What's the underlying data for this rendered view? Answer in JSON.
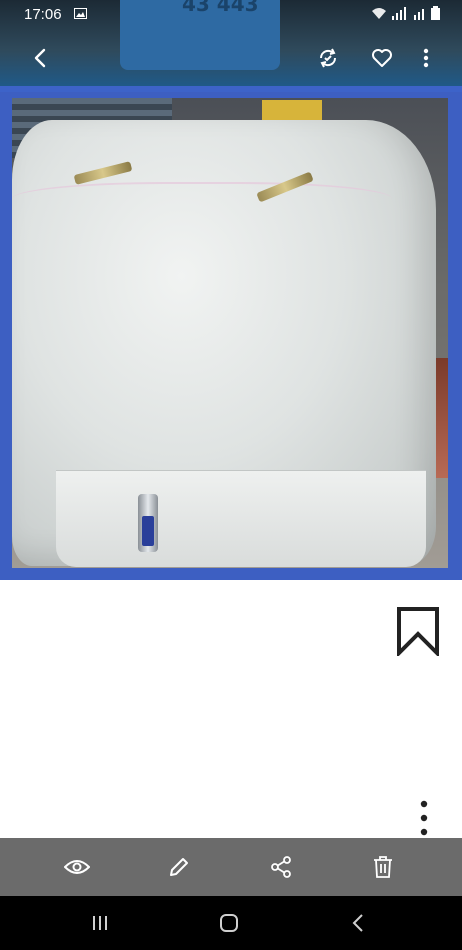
{
  "status_bar": {
    "time": "17:06"
  },
  "app_bar": {
    "icons": [
      "back-arrow-icon",
      "rotate-icon",
      "heart-icon",
      "more-vert-icon"
    ]
  },
  "photo": {
    "description_text_visible_on_box": "43 443"
  },
  "actions": {
    "bookmark": "bookmark-icon",
    "more": "more-vert-icon"
  },
  "toolbar": {
    "icons": [
      "eye-icon",
      "edit-pencil-icon",
      "share-icon",
      "delete-icon"
    ]
  },
  "colors": {
    "photo_frame": "#3d5fc2",
    "toolbar_bg": "#6b6b6b",
    "navbar_bg": "#000000"
  }
}
